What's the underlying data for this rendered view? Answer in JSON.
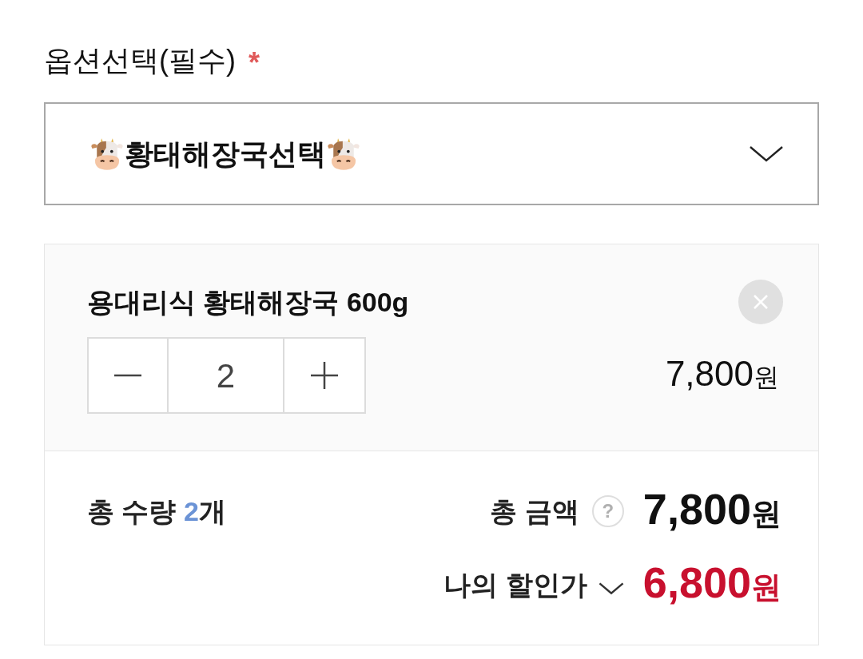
{
  "option_field": {
    "label": "옵션선택(필수)",
    "required_mark": "*"
  },
  "option_select": {
    "label": "황태해장국선택",
    "expanded": false
  },
  "selected_items": [
    {
      "name": "용대리식 황태해장국 600g",
      "quantity": "2",
      "price": "7,800",
      "price_unit": "원"
    }
  ],
  "summary": {
    "quantity_label": "총 수량",
    "quantity": "2",
    "quantity_unit": "개",
    "amount_label": "총 금액",
    "help_mark": "?",
    "amount": "7,800",
    "amount_unit": "원",
    "discount_label": "나의 할인가",
    "discount_expanded": false,
    "discount_amount": "6,800",
    "discount_unit": "원"
  }
}
